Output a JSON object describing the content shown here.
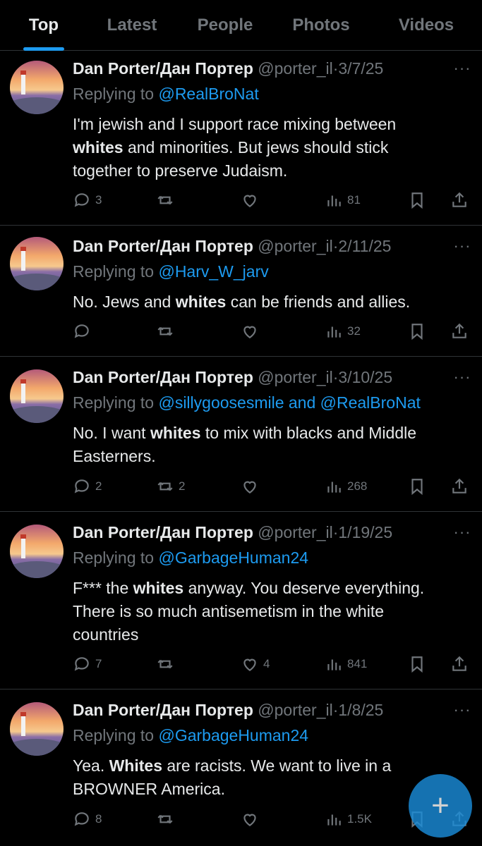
{
  "tabs": [
    {
      "label": "Top"
    },
    {
      "label": "Latest"
    },
    {
      "label": "People"
    },
    {
      "label": "Photos"
    },
    {
      "label": "Videos"
    }
  ],
  "accent_color": "#1d9bf0",
  "tweets": [
    {
      "name": "Dan Porter/Дан Портер",
      "handle": "@porter_il",
      "sep": "·",
      "date": "3/7/25",
      "reply_prefix": "Replying to",
      "mention1": "@RealBroNat",
      "reply_and": "",
      "mention2": "",
      "text1": "I'm jewish and I support race mixing between",
      "bold1": "whites",
      "text2": " and minorities. But jews should stick",
      "text3": "together to preserve Judaism.",
      "replies": "3",
      "retweets": "",
      "likes": "",
      "views": "81"
    },
    {
      "name": "Dan Porter/Дан Портер",
      "handle": "@porter_il",
      "sep": "·",
      "date": "2/11/25",
      "reply_prefix": "Replying to",
      "mention1": "@Harv_W_jarv",
      "reply_and": "",
      "mention2": "",
      "text1": "No. Jews and ",
      "bold1": "whites",
      "text2": " can be friends and allies.",
      "replies": "",
      "retweets": "",
      "likes": "",
      "views": "32"
    },
    {
      "name": "Dan Porter/Дан Портер",
      "handle": "@porter_il",
      "sep": "·",
      "date": "3/10/25",
      "reply_prefix": "Replying to",
      "mention1": "@sillygoosesmile",
      "reply_and": " and ",
      "mention2": "@RealBroNat",
      "text1": "No. I want ",
      "bold1": "whites",
      "text2": " to mix with blacks and Middle",
      "text3": "Easterners.",
      "replies": "2",
      "retweets": "2",
      "likes": "",
      "views": "268"
    },
    {
      "name": "Dan Porter/Дан Портер",
      "handle": "@porter_il",
      "sep": "·",
      "date": "1/19/25",
      "reply_prefix": "Replying to",
      "mention1": "@GarbageHuman24",
      "reply_and": "",
      "mention2": "",
      "text1": "F*** the ",
      "bold1": "whites",
      "text2": " anyway. You deserve everything.",
      "text3": "There is so much antisemetism in the white",
      "text4": "countries",
      "replies": "7",
      "retweets": "",
      "likes": "4",
      "views": "841"
    },
    {
      "name": "Dan Porter/Дан Портер",
      "handle": "@porter_il",
      "sep": "·",
      "date": "1/8/25",
      "reply_prefix": "Replying to",
      "mention1": "@GarbageHuman24",
      "reply_and": "",
      "mention2": "",
      "text1": "Yea. ",
      "bold1": "Whites",
      "text2": " are racists. We want to live in a",
      "text3": "BROWNER America.",
      "replies": "8",
      "retweets": "",
      "likes": "",
      "views": "1.5K"
    }
  ],
  "fab_icon": "plus-icon"
}
